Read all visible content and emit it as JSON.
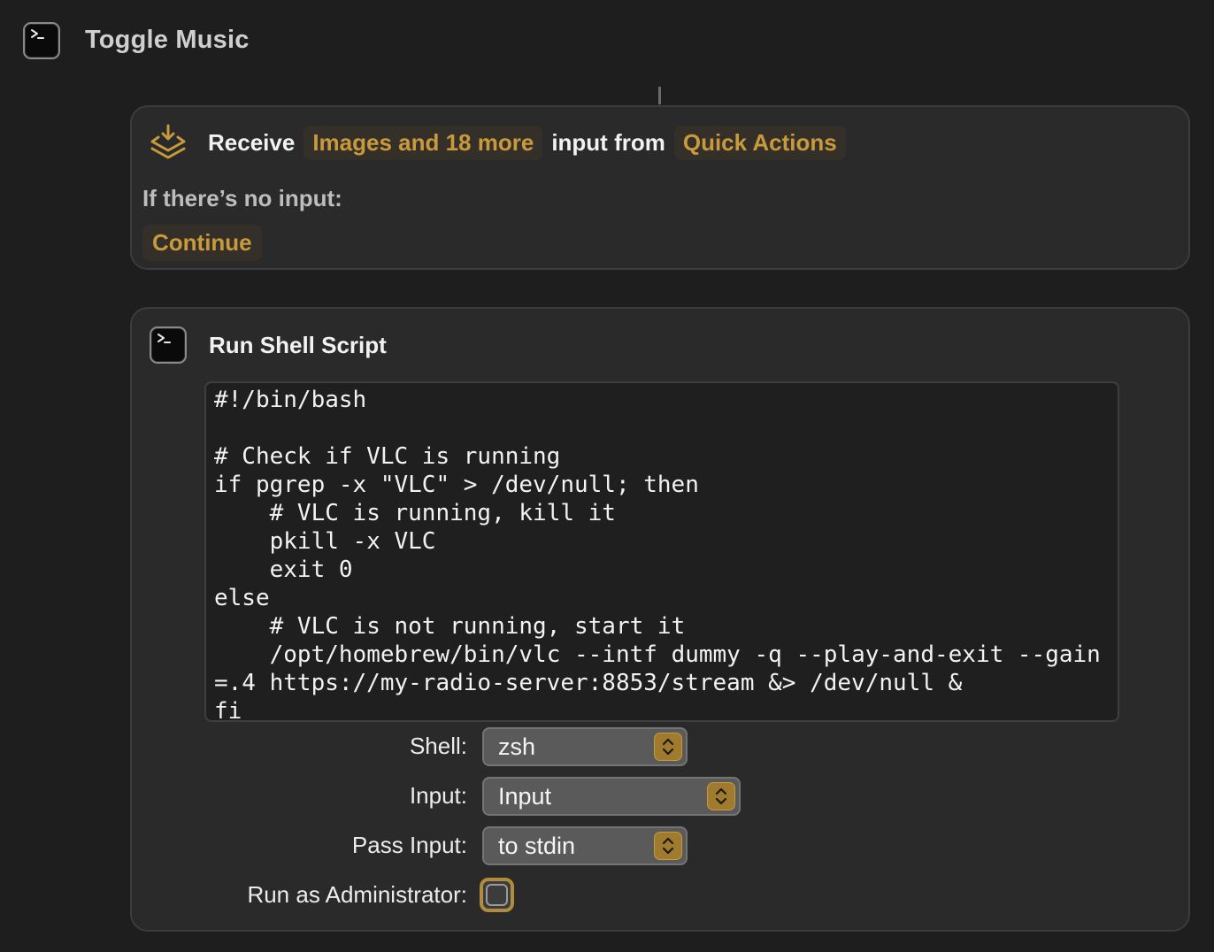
{
  "window": {
    "title": "Toggle Music"
  },
  "receive": {
    "verb": "Receive",
    "types_token": "Images and 18 more",
    "mid_text": "input from",
    "source_token": "Quick Actions",
    "no_input_label": "If there’s no input:",
    "no_input_token": "Continue"
  },
  "shell_action": {
    "title": "Run Shell Script",
    "script": "#!/bin/bash\n\n# Check if VLC is running\nif pgrep -x \"VLC\" > /dev/null; then\n    # VLC is running, kill it\n    pkill -x VLC\n    exit 0\nelse\n    # VLC is not running, start it\n    /opt/homebrew/bin/vlc --intf dummy -q --play-and-exit --gain=.4 https://my-radio-server:8853/stream &> /dev/null &\nfi",
    "shell_label": "Shell:",
    "shell_value": "zsh",
    "input_label": "Input:",
    "input_value": "Input",
    "pass_label": "Pass Input:",
    "pass_value": "to stdin",
    "admin_label": "Run as Administrator:"
  },
  "icons": {
    "title": "terminal-icon",
    "receive": "receive-input-icon",
    "shell": "terminal-icon",
    "popup": "up-down-chevron-icon"
  },
  "colors": {
    "accent": "#c89a3c",
    "stepper": "#a07a2d",
    "background": "#1e1e1e",
    "card": "#2a2a2a"
  }
}
